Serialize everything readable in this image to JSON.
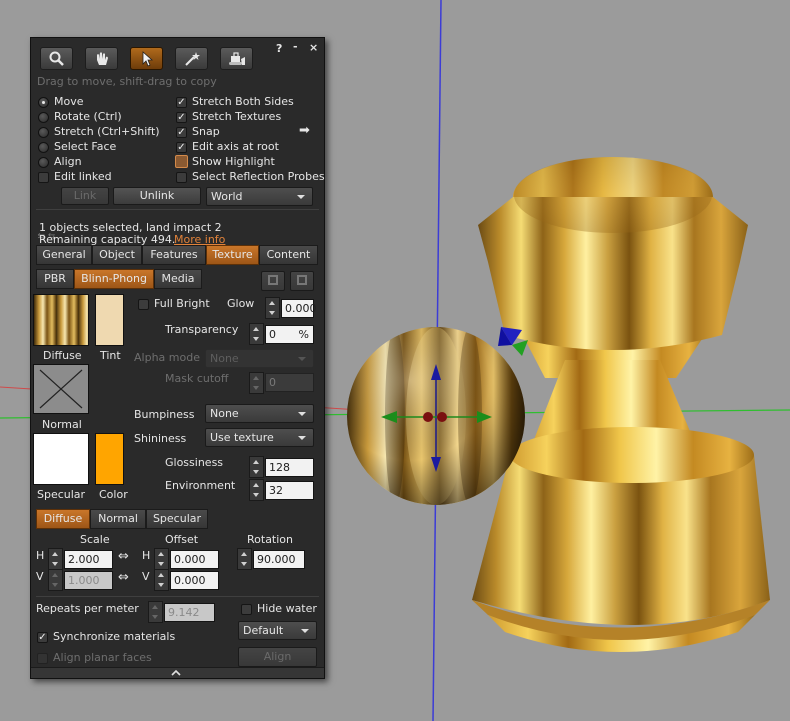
{
  "toolbar": {
    "help": "?",
    "minimize": "-",
    "close": "×",
    "tools": [
      {
        "icon": "zoom-magnifier-icon"
      },
      {
        "icon": "grab-hand-icon"
      },
      {
        "icon": "edit-pointer-icon",
        "active": true
      },
      {
        "icon": "create-wand-icon"
      },
      {
        "icon": "land-bulldozer-icon"
      }
    ],
    "hint": "Drag to move, shift-drag to copy"
  },
  "modes": {
    "move": "Move",
    "rotate": "Rotate (Ctrl)",
    "stretch": "Stretch (Ctrl+Shift)",
    "select_face": "Select Face",
    "align": "Align",
    "edit_linked": "Edit linked"
  },
  "options": {
    "stretch_both_sides": "Stretch Both Sides",
    "stretch_textures": "Stretch Textures",
    "snap": "Snap",
    "edit_axis_at_root": "Edit axis at root",
    "show_highlight": "Show Highlight",
    "select_reflection_probes": "Select Reflection Probes"
  },
  "link_row": {
    "link": "Link",
    "unlink": "Unlink",
    "ruler": "World"
  },
  "status": {
    "selected": "1 objects selected, land impact 2",
    "remaining": "Remaining capacity 494.",
    "more_info": "More info"
  },
  "tabs": [
    "General",
    "Object",
    "Features",
    "Texture",
    "Content"
  ],
  "subtabs": [
    "PBR",
    "Blinn-Phong",
    "Media"
  ],
  "texture": {
    "diffuse_label": "Diffuse",
    "tint_label": "Tint",
    "normal_label": "Normal",
    "specular_label": "Specular",
    "color_label": "Color",
    "full_bright": "Full Bright",
    "glow_label": "Glow",
    "glow_value": "0.000",
    "transparency_label": "Transparency",
    "transparency_value": "0",
    "transparency_unit": "%",
    "alpha_mode_label": "Alpha mode",
    "alpha_mode_value": "None",
    "mask_cutoff_label": "Mask cutoff",
    "mask_cutoff_value": "0",
    "bumpiness_label": "Bumpiness",
    "bumpiness_value": "None",
    "shininess_label": "Shininess",
    "shininess_value": "Use texture",
    "glossiness_label": "Glossiness",
    "glossiness_value": "128",
    "environment_label": "Environment",
    "environment_value": "32",
    "tint_color": "#efd9b0",
    "specular_color": "#ffffff",
    "spec_color": "#ffa500"
  },
  "map_tabs": [
    "Diffuse",
    "Normal",
    "Specular"
  ],
  "transform": {
    "scale_label": "Scale",
    "offset_label": "Offset",
    "rotation_label": "Rotation",
    "h": "H",
    "v": "V",
    "scale_h": "2.000",
    "scale_v": "1.000",
    "offset_h": "0.000",
    "offset_v": "0.000",
    "rotation": "90.000"
  },
  "bottom": {
    "repeats_label": "Repeats per meter",
    "repeats_value": "9.142",
    "hide_water": "Hide water",
    "sync_materials": "Synchronize materials",
    "align_mode": "Default",
    "align_planar": "Align planar faces",
    "align_button": "Align"
  }
}
